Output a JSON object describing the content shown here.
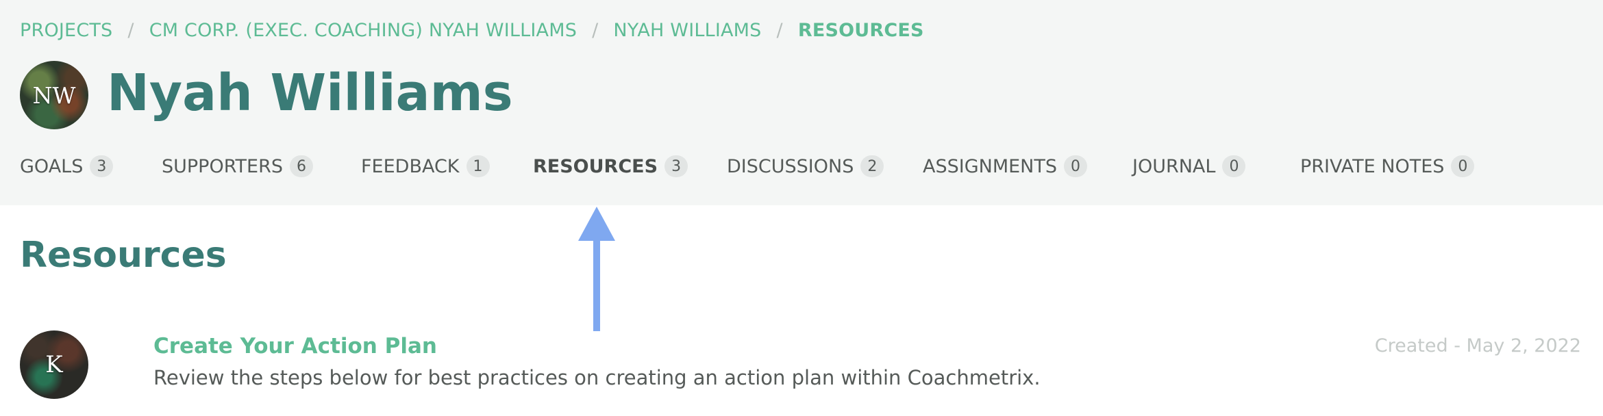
{
  "breadcrumb": {
    "items": [
      {
        "label": "PROJECTS"
      },
      {
        "label": "CM CORP. (EXEC. COACHING) NYAH WILLIAMS"
      },
      {
        "label": "NYAH WILLIAMS"
      },
      {
        "label": "RESOURCES"
      }
    ],
    "separator": "/"
  },
  "profile": {
    "initials": "NW",
    "name": "Nyah Williams"
  },
  "tabs": [
    {
      "label": "GOALS",
      "count": "3",
      "active": false
    },
    {
      "label": "SUPPORTERS",
      "count": "6",
      "active": false
    },
    {
      "label": "FEEDBACK",
      "count": "1",
      "active": false
    },
    {
      "label": "RESOURCES",
      "count": "3",
      "active": true
    },
    {
      "label": "DISCUSSIONS",
      "count": "2",
      "active": false
    },
    {
      "label": "ASSIGNMENTS",
      "count": "0",
      "active": false
    },
    {
      "label": "JOURNAL",
      "count": "0",
      "active": false
    },
    {
      "label": "PRIVATE NOTES",
      "count": "0",
      "active": false
    }
  ],
  "section": {
    "title": "Resources"
  },
  "resources": [
    {
      "avatar_initial": "K",
      "title": "Create Your Action Plan",
      "description": "Review the steps below for best practices on creating an action plan within Coachmetrix.",
      "created": "Created - May 2, 2022"
    }
  ],
  "annotation": {
    "icon": "up-arrow-icon",
    "color": "#7fa8f0"
  },
  "colors": {
    "accent": "#5dbb94",
    "heading": "#3a7b76",
    "header_bg": "#f4f6f5"
  }
}
